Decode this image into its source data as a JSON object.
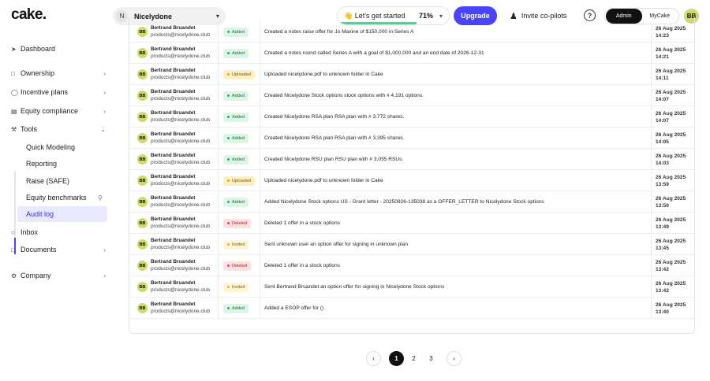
{
  "header": {
    "logo": "cake.",
    "workspace": {
      "initial": "N",
      "name": "Nicelydone"
    },
    "get_started": {
      "label": "👋 Let's get started",
      "percent_label": "71%",
      "progress": 0.71
    },
    "upgrade_label": "Upgrade",
    "invite_label": "Invite co-pilots",
    "help_glyph": "?",
    "roles": [
      "Admin",
      "MyCake"
    ],
    "active_role": "Admin",
    "user_initials": "BB"
  },
  "sidebar": {
    "items": [
      {
        "label": "Dashboard",
        "icon": "rocket-icon"
      },
      {
        "label": "Ownership",
        "icon": "box-icon"
      },
      {
        "label": "Incentive plans",
        "icon": "ribbon-icon"
      },
      {
        "label": "Equity compliance",
        "icon": "document-icon"
      },
      {
        "label": "Tools",
        "icon": "tools-icon"
      },
      {
        "label": "Inbox",
        "icon": "inbox-icon"
      },
      {
        "label": "Documents",
        "icon": "documents-icon"
      },
      {
        "label": "Company",
        "icon": "gear-icon"
      }
    ],
    "tools_sub": [
      {
        "label": "Quick Modeling"
      },
      {
        "label": "Reporting"
      },
      {
        "label": "Raise (SAFE)"
      },
      {
        "label": "Equity benchmarks"
      },
      {
        "label": "Audit log"
      }
    ]
  },
  "audit": {
    "rows": [
      {
        "initials": "BB",
        "name": "Bertrand Bruandet",
        "email": "products@nicelydone.club",
        "action": "Added",
        "type": "added",
        "desc": "Created a notes raise offer for Jo Maxine of $150,000 in Series A",
        "date": "26 Aug 2025",
        "time": "14:23"
      },
      {
        "initials": "BB",
        "name": "Bertrand Bruandet",
        "email": "products@nicelydone.club",
        "action": "Added",
        "type": "added",
        "desc": "Created a notes round called Series A with a goal of $1,000,000 and an end date of 2026-12-31",
        "date": "26 Aug 2025",
        "time": "14:21"
      },
      {
        "initials": "BB",
        "name": "Bertrand Bruandet",
        "email": "products@nicelydone.club",
        "action": "Uploaded",
        "type": "uploaded",
        "desc": "Uploaded nicelydone.pdf to unknown folder in Cake",
        "date": "26 Aug 2025",
        "time": "14:11"
      },
      {
        "initials": "BB",
        "name": "Bertrand Bruandet",
        "email": "products@nicelydone.club",
        "action": "Added",
        "type": "added",
        "desc": "Created Nicelydone Stock options stock options with # 4,191 options.",
        "date": "26 Aug 2025",
        "time": "14:07"
      },
      {
        "initials": "BB",
        "name": "Bertrand Bruandet",
        "email": "products@nicelydone.club",
        "action": "Added",
        "type": "added",
        "desc": "Created Nicelydone RSA plan RSA plan with # 3,772 shares.",
        "date": "26 Aug 2025",
        "time": "14:07"
      },
      {
        "initials": "BB",
        "name": "Bertrand Bruandet",
        "email": "products@nicelydone.club",
        "action": "Added",
        "type": "added",
        "desc": "Created Nicelydone RSA plan RSA plan with # 3,395 shares.",
        "date": "26 Aug 2025",
        "time": "14:05"
      },
      {
        "initials": "BB",
        "name": "Bertrand Bruandet",
        "email": "products@nicelydone.club",
        "action": "Added",
        "type": "added",
        "desc": "Created Nicelydone RSU plan RSU plan with # 3,055 RSUs.",
        "date": "26 Aug 2025",
        "time": "14:03"
      },
      {
        "initials": "BB",
        "name": "Bertrand Bruandet",
        "email": "products@nicelydone.club",
        "action": "Uploaded",
        "type": "uploaded",
        "desc": "Uploaded nicelydone.pdf to unknown folder in Cake",
        "date": "26 Aug 2025",
        "time": "13:59"
      },
      {
        "initials": "BB",
        "name": "Bertrand Bruandet",
        "email": "products@nicelydone.club",
        "action": "Added",
        "type": "added",
        "desc": "Added Nicelydone Stock options US - Grant letter - 20250826-135038 as a OFFER_LETTER to Nicelydone Stock options",
        "date": "26 Aug 2025",
        "time": "13:50"
      },
      {
        "initials": "BB",
        "name": "Bertrand Bruandet",
        "email": "products@nicelydone.club",
        "action": "Deleted",
        "type": "deleted",
        "desc": "Deleted 1 offer in a stock options",
        "date": "26 Aug 2025",
        "time": "13:49"
      },
      {
        "initials": "BB",
        "name": "Bertrand Bruandet",
        "email": "products@nicelydone.club",
        "action": "Invited",
        "type": "invited",
        "desc": "Sent unknown user an option offer for signing in unknown plan",
        "date": "26 Aug 2025",
        "time": "13:45"
      },
      {
        "initials": "BB",
        "name": "Bertrand Bruandet",
        "email": "products@nicelydone.club",
        "action": "Deleted",
        "type": "deleted",
        "desc": "Deleted 1 offer in a stock options",
        "date": "26 Aug 2025",
        "time": "13:42"
      },
      {
        "initials": "BB",
        "name": "Bertrand Bruandet",
        "email": "products@nicelydone.club",
        "action": "Invited",
        "type": "invited",
        "desc": "Sent Bertrand Bruandet an option offer for signing in Nicelydone Stock options",
        "date": "26 Aug 2025",
        "time": "13:42"
      },
      {
        "initials": "BB",
        "name": "Bertrand Bruandet",
        "email": "products@nicelydone.club",
        "action": "Added",
        "type": "added",
        "desc": "Added a ESOP offer for ()",
        "date": "26 Aug 2025",
        "time": "13:40"
      }
    ]
  },
  "pagination": {
    "pages": [
      "1",
      "2",
      "3"
    ],
    "current": "1",
    "prev_glyph": "‹",
    "next_glyph": "›"
  }
}
